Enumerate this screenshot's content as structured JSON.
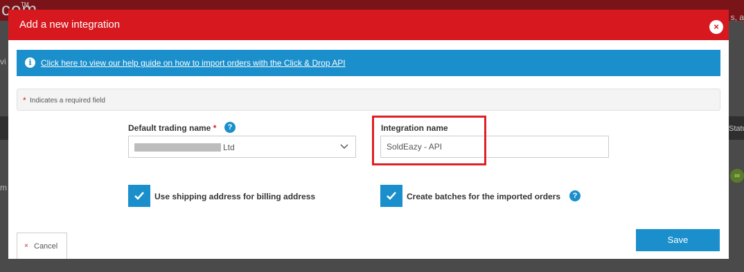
{
  "background": {
    "logo_text": "com",
    "tm": "TM",
    "top_right_text": "s, a",
    "left_text_w": "vi",
    "left_text_m": "m",
    "status_text": "Statu"
  },
  "modal": {
    "title": "Add a new integration",
    "close_label": "×"
  },
  "help_banner": {
    "link_text": "Click here to view our help guide on how to import orders with the Click & Drop API"
  },
  "required_note": {
    "star": "*",
    "text": "Indicates a required field"
  },
  "form": {
    "trading_name": {
      "label": "Default trading name",
      "required_star": "*",
      "help": "?",
      "value_suffix": "Ltd"
    },
    "integration_name": {
      "label": "Integration name",
      "value": "SoldEazy - API"
    },
    "checkboxes": [
      {
        "label": "Use shipping address for billing address",
        "checked": true
      },
      {
        "label": "Create batches for the imported orders",
        "checked": true,
        "help": "?"
      }
    ]
  },
  "actions": {
    "cancel_label": "Cancel",
    "cancel_icon": "×",
    "save_label": "Save"
  },
  "colors": {
    "header_red": "#d7191f",
    "accent_blue": "#1a8fcb",
    "highlight_red": "#e01e25"
  }
}
